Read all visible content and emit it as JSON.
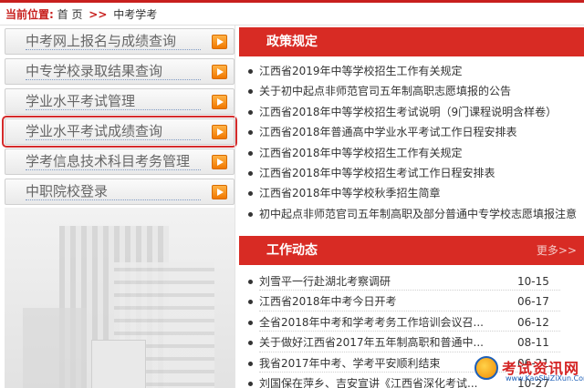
{
  "breadcrumb": {
    "label": "当前位置:",
    "home": "首 页",
    "separator": ">>",
    "current": "中考学考"
  },
  "menu": {
    "items": [
      {
        "label": "中考网上报名与成绩查询"
      },
      {
        "label": "中专学校录取结果查询"
      },
      {
        "label": "学业水平考试管理"
      },
      {
        "label": "学业水平考试成绩查询",
        "selected": true
      },
      {
        "label": "学考信息技术科目考务管理"
      },
      {
        "label": "中职院校登录"
      }
    ]
  },
  "policy": {
    "title": "政策规定",
    "items": [
      {
        "title": "江西省2019年中等学校招生工作有关规定"
      },
      {
        "title": "关于初中起点非师范官司五年制高职志愿填报的公告"
      },
      {
        "title": "江西省2018年中等学校招生考试说明（9门课程说明含样卷）"
      },
      {
        "title": "江西省2018年普通高中学业水平考试工作日程安排表"
      },
      {
        "title": "江西省2018年中等学校招生工作有关规定"
      },
      {
        "title": "江西省2018年中等学校招生考试工作日程安排表"
      },
      {
        "title": "江西省2018年中等学校秋季招生简章"
      },
      {
        "title": "初中起点非师范官司五年制高职及部分普通中专学校志愿填报注意"
      }
    ]
  },
  "work": {
    "title": "工作动态",
    "more": "更多>>",
    "items": [
      {
        "title": "刘雪平一行赴湖北考察调研",
        "date": "10-15"
      },
      {
        "title": "江西省2018年中考今日开考",
        "date": "06-17"
      },
      {
        "title": "全省2018年中考和学考考务工作培训会议召...",
        "date": "06-12"
      },
      {
        "title": "关于做好江西省2017年五年制高职和普通中...",
        "date": "08-11"
      },
      {
        "title": "我省2017年中考、学考平安顺利结束",
        "date": "06-21"
      },
      {
        "title": "刘国保在萍乡、吉安宣讲《江西省深化考试...",
        "date": "10-27"
      }
    ]
  },
  "watermark": {
    "text": "考试资讯网",
    "sub": "www.KaoShiZiXun.Com"
  },
  "colors": {
    "accent_red": "#d82b24",
    "menu_arrow_orange": "#f07800",
    "selection_outline": "#d42b2b"
  }
}
